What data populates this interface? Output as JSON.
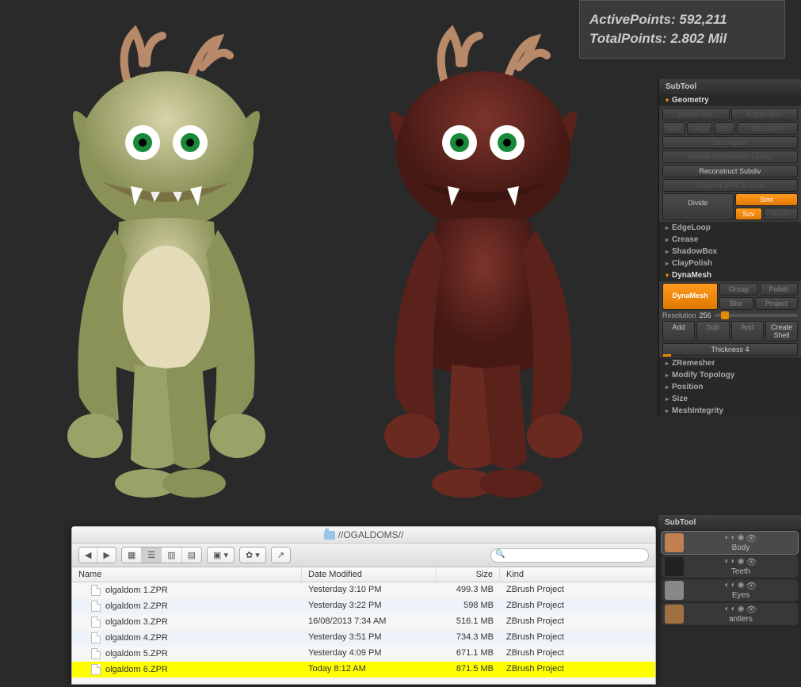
{
  "stats": {
    "active_label": "ActivePoints:",
    "active_value": "592,211",
    "total_label": "TotalPoints:",
    "total_value": "2.802 Mil"
  },
  "panel": {
    "subtool_header": "SubTool",
    "sections": {
      "geometry": {
        "label": "Geometry",
        "lower_res": "Lower Res",
        "higher_res": "Higher Res",
        "sdiv": "SDiv",
        "cage": "Cage",
        "rstr": "Rstr",
        "del_lower": "Del Lower",
        "del_higher": "Del Higher",
        "freeze": "Freeze SubDivision Levels",
        "reconstruct": "Reconstruct Subdiv",
        "convert": "Convert BPR To Geo",
        "divide": "Divide",
        "smt": "Smt",
        "suv": "Suv",
        "reuv": "ReUV"
      },
      "edgeloop": "EdgeLoop",
      "crease": "Crease",
      "shadowbox": "ShadowBox",
      "claypolish": "ClayPolish",
      "dynamesh": {
        "label": "DynaMesh",
        "button": "DynaMesh",
        "group": "Group",
        "polish": "Polish",
        "blur": "Blur",
        "project": "Project",
        "resolution_label": "Resolution",
        "resolution_value": "256",
        "add": "Add",
        "sub": "Sub",
        "and": "And",
        "create_shell": "Create Shell",
        "thickness_label": "Thickness",
        "thickness_value": "4"
      },
      "zremesher": "ZRemesher",
      "modify_topology": "Modify Topology",
      "position": "Position",
      "size": "Size",
      "mesh_integrity": "MeshIntegrity"
    }
  },
  "subtools": {
    "header": "SubTool",
    "items": [
      {
        "name": "Body"
      },
      {
        "name": "Teeth"
      },
      {
        "name": "Eyes"
      },
      {
        "name": "antlers"
      }
    ]
  },
  "finder": {
    "title": "//OGALDOMS//",
    "columns": {
      "name": "Name",
      "date": "Date Modified",
      "size": "Size",
      "kind": "Kind"
    },
    "rows": [
      {
        "name": "olgaldom 1.ZPR",
        "date": "Yesterday 3:10 PM",
        "size": "499.3 MB",
        "kind": "ZBrush Project"
      },
      {
        "name": "olgaldom 2.ZPR",
        "date": "Yesterday 3:22 PM",
        "size": "598 MB",
        "kind": "ZBrush Project"
      },
      {
        "name": "olgaldom 3.ZPR",
        "date": "16/08/2013 7:34 AM",
        "size": "516.1 MB",
        "kind": "ZBrush Project"
      },
      {
        "name": "olgaldom 4.ZPR",
        "date": "Yesterday 3:51 PM",
        "size": "734.3 MB",
        "kind": "ZBrush Project"
      },
      {
        "name": "olgaldom 5.ZPR",
        "date": "Yesterday 4:09 PM",
        "size": "671.1 MB",
        "kind": "ZBrush Project"
      },
      {
        "name": "olgaldom 6.ZPR",
        "date": "Today 8:12 AM",
        "size": "871.5 MB",
        "kind": "ZBrush Project"
      }
    ],
    "highlighted_index": 5
  }
}
